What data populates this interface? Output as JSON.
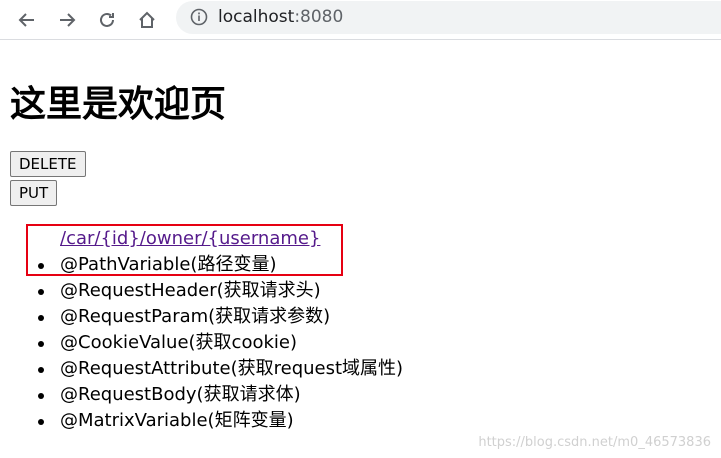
{
  "browser": {
    "url_host": "localhost",
    "url_port": ":8080",
    "icons": {
      "back": "arrow-left-icon",
      "forward": "arrow-right-icon",
      "reload": "reload-icon",
      "home": "home-icon",
      "info": "info-icon"
    }
  },
  "page": {
    "title": "这里是欢迎页",
    "buttons": {
      "delete_label": "DELETE",
      "put_label": "PUT"
    },
    "list": {
      "link": "/car/{id}/owner/{username}",
      "items": [
        "@PathVariable(路径变量)",
        "@RequestHeader(获取请求头)",
        "@RequestParam(获取请求参数)",
        "@CookieValue(获取cookie)",
        "@RequestAttribute(获取request域属性)",
        "@RequestBody(获取请求体)",
        "@MatrixVariable(矩阵变量)"
      ]
    },
    "annotation_color": "#e60012"
  },
  "watermark": "https://blog.csdn.net/m0_46573836"
}
